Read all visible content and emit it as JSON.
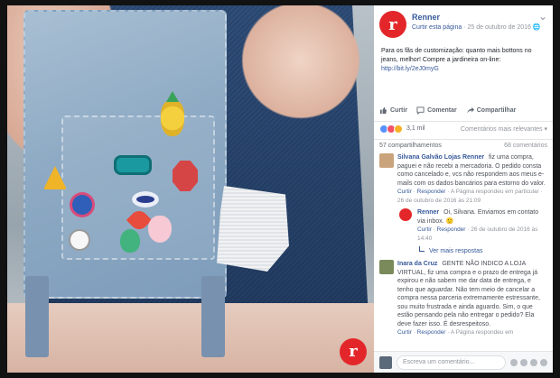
{
  "post": {
    "page_name": "Renner",
    "follow_label": "Curtir esta página",
    "date": "25 de outubro de 2016",
    "privacy_icon": "globe-icon",
    "logo_letter": "r",
    "text": "Para os fãs de customização: quanto mais bottons no jeans, melhor! Compre a jardineira on-line:",
    "link": "http://bit.ly/2eJ0myG"
  },
  "actions": {
    "like": "Curtir",
    "comment": "Comentar",
    "share": "Compartilhar"
  },
  "reactions": {
    "count": "3,1 mil",
    "sort": "Comentários mais relevantes ▾"
  },
  "shares": {
    "shares": "57 compartilhamentos",
    "comments": "68 comentários"
  },
  "comments": [
    {
      "name": "Silvana Galvão Lojas Renner",
      "text": "fiz uma compra, paguei e não recebi a mercadoria. O pedido consta como cancelado e, vcs não respondem aos meus e-mails com os dados bancários para estorno do valor.",
      "replied": "A Página respondeu em particular",
      "time": "26 de outubro de 2016 às 21:09",
      "avatar_color": "#c9a37c"
    },
    {
      "name": "Renner",
      "text": "Oi, Silvana. Enviamos em contato via inbox. 🙂",
      "time": "26 de outubro de 2016 às 14:40",
      "avatar_color": "#e3262a",
      "is_reply": true
    },
    {
      "name": "Inara da Cruz",
      "text": "GENTE NÃO INDICO A LOJA VIRTUAL, fiz uma compra e o prazo de entrega já expirou e não sabem me dar data de entrega, e tenho que aguardar. Não tem meio de cancelar a compra nessa parceria extremamente estressante, sou muito frustrada e ainda aguardo. Sim, o que estão pensando pela não entregar o pedido? Ela deve fazer isso. É desrespeitoso.",
      "replied": "A Página respondeu em",
      "time": "",
      "avatar_color": "#7a8a5a"
    }
  ],
  "more_replies": "Ver mais respostas",
  "reply_labels": {
    "like": "Curtir",
    "reply": "Responder"
  },
  "composer": {
    "placeholder": "Escreva um comentário..."
  }
}
